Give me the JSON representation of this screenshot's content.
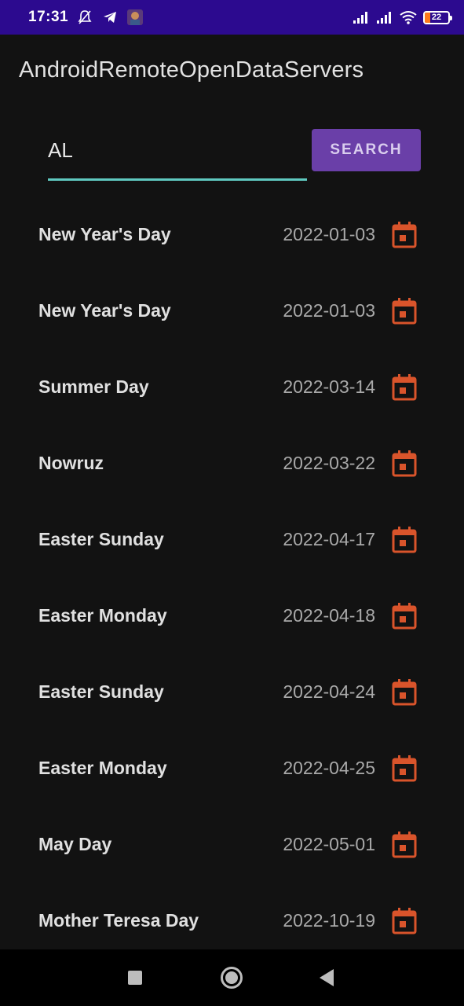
{
  "status_bar": {
    "time": "17:31",
    "icons": [
      "bell-off-icon",
      "telegram-icon",
      "app-avatar-icon"
    ],
    "right_icons": [
      "signal-icon",
      "signal-icon-2",
      "wifi-icon"
    ],
    "battery_level": "22",
    "background": "#2c0a8f"
  },
  "app_bar": {
    "title": "AndroidRemoteOpenDataServers"
  },
  "search": {
    "input_value": "AL",
    "button_label": "SEARCH",
    "accent_color": "#5fc9c0",
    "button_color": "#6a3fa8"
  },
  "holidays": [
    {
      "name": "New Year's Day",
      "date": "2022-01-03"
    },
    {
      "name": "New Year's Day",
      "date": "2022-01-03"
    },
    {
      "name": "Summer Day",
      "date": "2022-03-14"
    },
    {
      "name": "Nowruz",
      "date": "2022-03-22"
    },
    {
      "name": "Easter Sunday",
      "date": "2022-04-17"
    },
    {
      "name": "Easter Monday",
      "date": "2022-04-18"
    },
    {
      "name": "Easter Sunday",
      "date": "2022-04-24"
    },
    {
      "name": "Easter Monday",
      "date": "2022-04-25"
    },
    {
      "name": "May Day",
      "date": "2022-05-01"
    },
    {
      "name": "Mother Teresa Day",
      "date": "2022-10-19"
    }
  ],
  "calendar_icon_color": "#d9542b",
  "nav_bar": {
    "buttons": [
      "recents-button",
      "home-button",
      "back-button"
    ]
  }
}
